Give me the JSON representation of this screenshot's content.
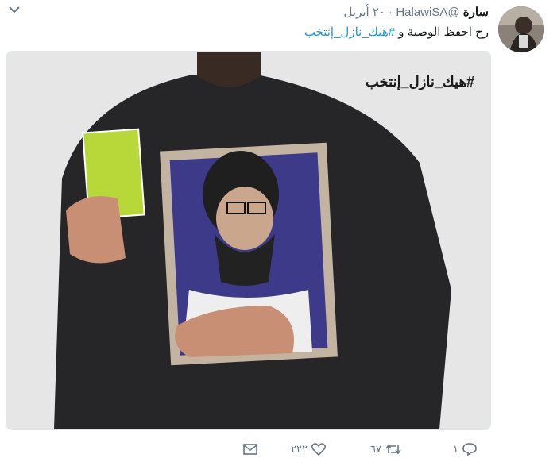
{
  "tweet": {
    "name": "سارة",
    "handle": "@HalawiSA",
    "dot": "·",
    "time": "٢٠ أبريل",
    "text_prefix": "رح احفظ الوصية و ",
    "hashtag": "#هيك_نازل_إنتخب"
  },
  "media": {
    "overlay_hashtag": "#هيك_نازل_إنتخب"
  },
  "actions": {
    "reply_count": "١",
    "retweet_count": "٦٧",
    "like_count": "٢٢٢"
  },
  "icons": [
    "chevron-down-icon",
    "reply-icon",
    "retweet-icon",
    "heart-icon",
    "envelope-icon"
  ],
  "colors": {
    "link": "#1b95e0",
    "muted": "#657786",
    "text": "#14171a"
  }
}
